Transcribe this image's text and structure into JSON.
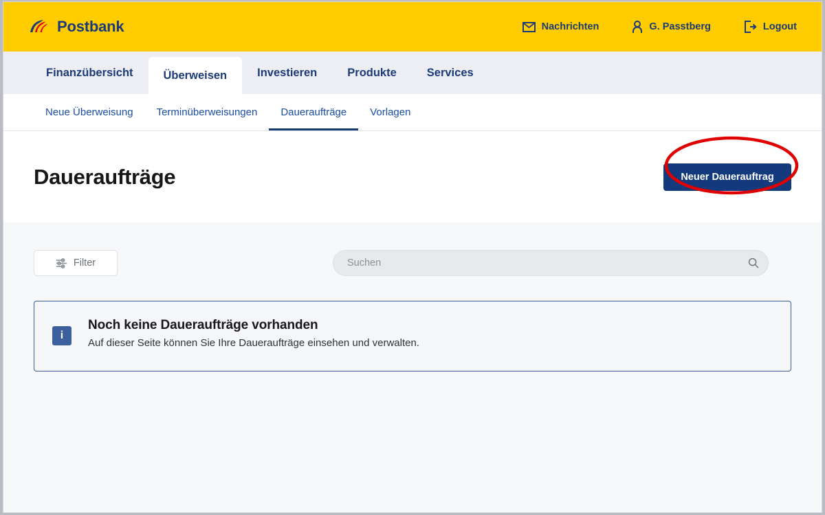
{
  "brand": {
    "name": "Postbank",
    "logo_icon": "postbank-swoosh-icon",
    "header_bg": "#ffcc00",
    "navy": "#1b3a77",
    "red": "#e2001a"
  },
  "header": {
    "items": [
      {
        "label": "Nachrichten",
        "icon": "envelope-icon"
      },
      {
        "label": "G. Passtberg",
        "icon": "user-icon"
      },
      {
        "label": "Logout",
        "icon": "logout-icon"
      }
    ]
  },
  "nav_main": {
    "tabs": [
      {
        "label": "Finanzübersicht",
        "active": false
      },
      {
        "label": "Überweisen",
        "active": true
      },
      {
        "label": "Investieren",
        "active": false
      },
      {
        "label": "Produkte",
        "active": false
      },
      {
        "label": "Services",
        "active": false
      }
    ]
  },
  "nav_sub": {
    "tabs": [
      {
        "label": "Neue Überweisung",
        "active": false
      },
      {
        "label": "Terminüberweisungen",
        "active": false
      },
      {
        "label": "Daueraufträge",
        "active": true
      },
      {
        "label": "Vorlagen",
        "active": false
      }
    ]
  },
  "main": {
    "page_title": "Daueraufträge",
    "primary_button": {
      "label": "Neuer Dauerauftrag",
      "bg": "#133a7c",
      "annotation": "red-ellipse-highlight",
      "annotation_color": "#e00000"
    },
    "filter_button": {
      "label": "Filter",
      "icon": "sliders-icon"
    },
    "search": {
      "placeholder": "Suchen",
      "value": "",
      "icon": "search-icon"
    },
    "info_box": {
      "icon": "info-icon",
      "icon_glyph": "i",
      "title": "Noch keine Daueraufträge vorhanden",
      "text": "Auf dieser Seite können Sie Ihre Daueraufträge einsehen und verwalten.",
      "border_color": "#3a5b9b",
      "icon_color": "#3c5f9e"
    }
  }
}
